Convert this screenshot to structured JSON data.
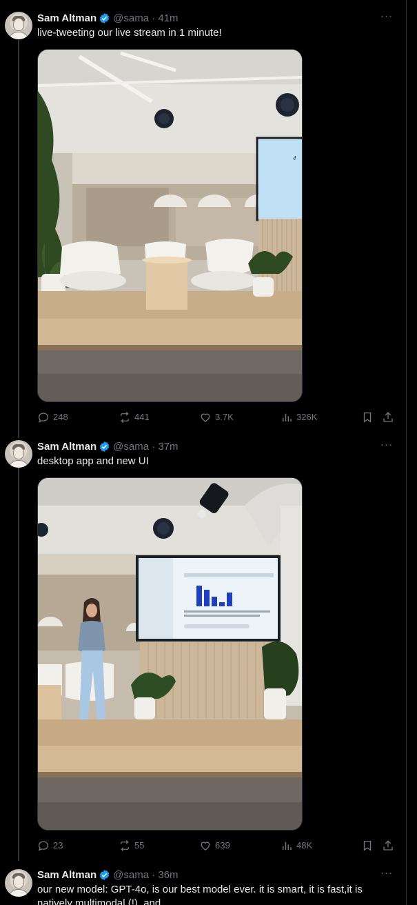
{
  "tweets": [
    {
      "author": "Sam Altman",
      "handle_time": "@sama · 41m",
      "text": "live-tweeting our live stream in 1 minute!",
      "replies": "248",
      "reposts": "441",
      "likes": "3.7K",
      "views": "326K",
      "screen_number": "4"
    },
    {
      "author": "Sam Altman",
      "handle_time": "@sama · 37m",
      "text": "desktop app and new UI",
      "replies": "23",
      "reposts": "55",
      "likes": "639",
      "views": "48K"
    },
    {
      "author": "Sam Altman",
      "handle_time": "@sama · 36m",
      "text": "our new model: GPT-4o, is our best model ever. it is smart, it is fast,it is natively multimodal (!), and…"
    }
  ],
  "icons": {
    "verified": "verified-badge-icon",
    "reply": "reply-icon",
    "repost": "repost-icon",
    "like": "heart-icon",
    "views": "views-chart-icon",
    "bookmark": "bookmark-icon",
    "share": "share-icon",
    "more": "more-dots-icon"
  },
  "colors": {
    "background": "#000000",
    "text": "#e7e9ea",
    "muted": "#71767b",
    "verified": "#1d9bf0",
    "border": "#2f3336"
  }
}
